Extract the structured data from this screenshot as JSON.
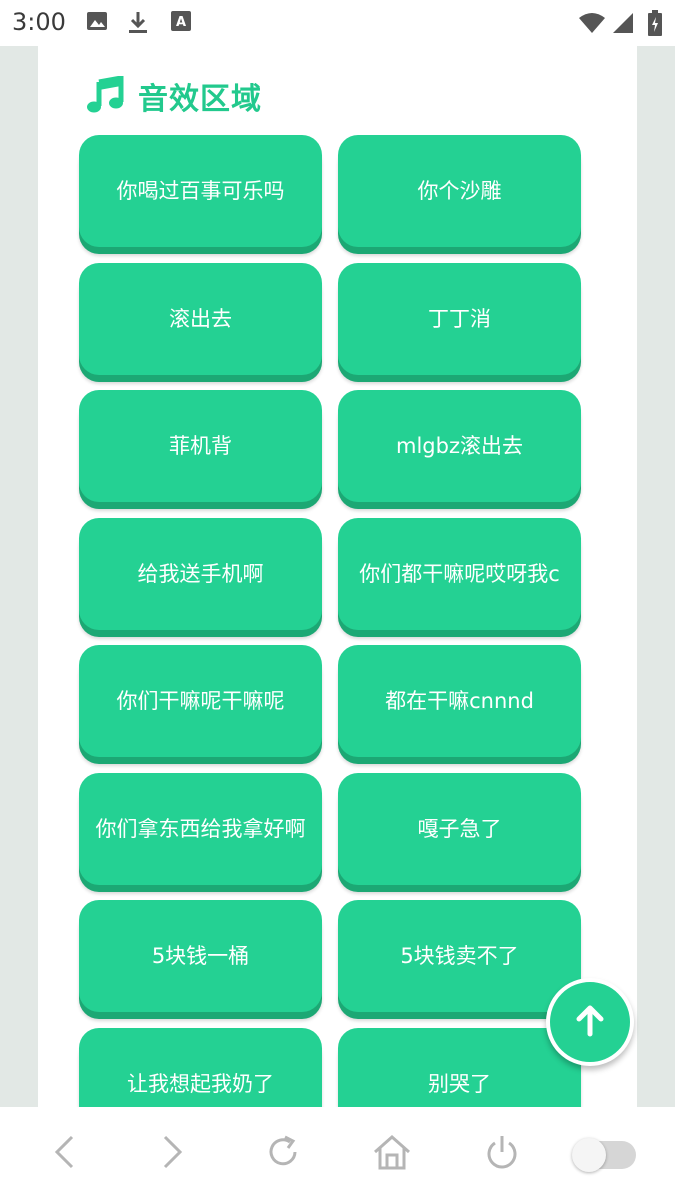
{
  "status_bar": {
    "time": "3:00",
    "icons_left": [
      "image-icon",
      "download-icon",
      "font-icon"
    ],
    "icons_right": [
      "wifi-icon",
      "signal-icon",
      "battery-icon"
    ]
  },
  "section": {
    "title": "音效区域",
    "icon": "music-note-icon",
    "accent_color": "#24d193"
  },
  "sound_buttons": [
    "你喝过百事可乐吗",
    "你个沙雕",
    "滚出去",
    "丁丁消",
    "菲机背",
    "mlgbz滚出去",
    "给我送手机啊",
    "你们都干嘛呢哎呀我c",
    "你们干嘛呢干嘛呢",
    "都在干嘛cnnnd",
    "你们拿东西给我拿好啊",
    "嘎子急了",
    "5块钱一桶",
    "5块钱卖不了",
    "让我想起我奶了",
    "别哭了"
  ],
  "back_to_top": {
    "icon": "arrow-up-icon"
  },
  "bottom_nav": {
    "items": [
      "back-icon",
      "forward-icon",
      "refresh-icon",
      "home-icon",
      "power-icon"
    ],
    "toggle": {
      "state": "off"
    }
  }
}
